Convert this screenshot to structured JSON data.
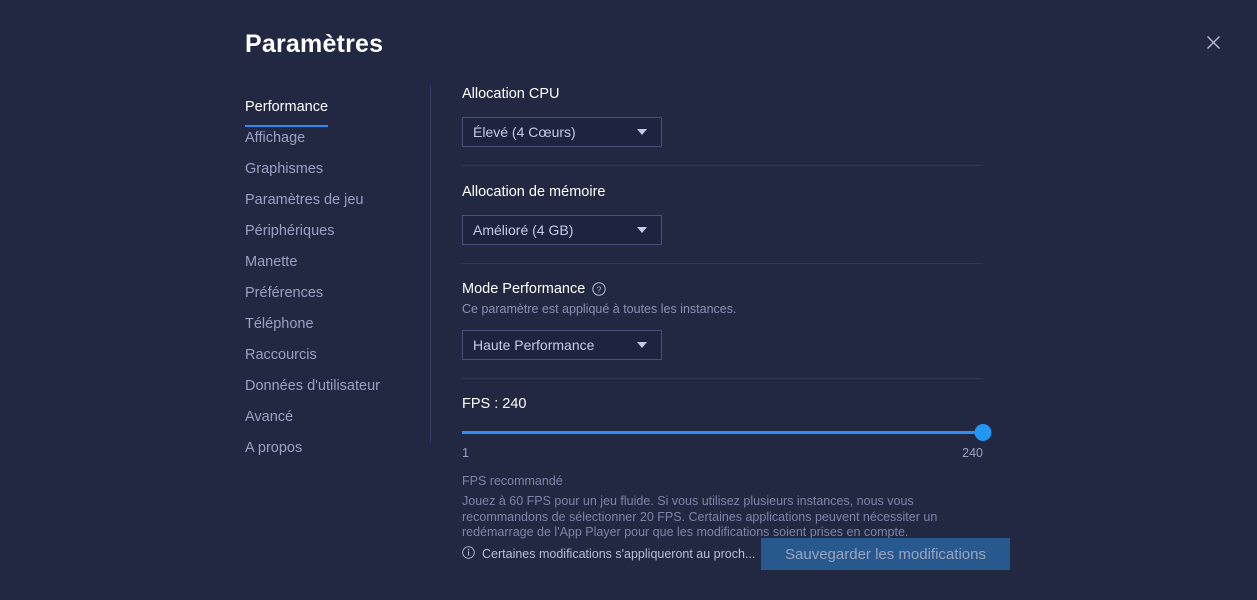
{
  "dialog": {
    "title": "Paramètres",
    "close_icon": "close-icon"
  },
  "sidebar": {
    "items": [
      {
        "label": "Performance",
        "active": true
      },
      {
        "label": "Affichage",
        "active": false
      },
      {
        "label": "Graphismes",
        "active": false
      },
      {
        "label": "Paramètres de jeu",
        "active": false
      },
      {
        "label": "Périphériques",
        "active": false
      },
      {
        "label": "Manette",
        "active": false
      },
      {
        "label": "Préférences",
        "active": false
      },
      {
        "label": "Téléphone",
        "active": false
      },
      {
        "label": "Raccourcis",
        "active": false
      },
      {
        "label": "Données d'utilisateur",
        "active": false
      },
      {
        "label": "Avancé",
        "active": false
      },
      {
        "label": "A propos",
        "active": false
      }
    ]
  },
  "content": {
    "cpu": {
      "label": "Allocation CPU",
      "selected": "Élevé (4 Cœurs)"
    },
    "memory": {
      "label": "Allocation de mémoire",
      "selected": "Amélioré (4 GB)"
    },
    "performance_mode": {
      "label": "Mode Performance",
      "help_icon": "help-circle-icon",
      "note": "Ce paramètre est appliqué à toutes les instances.",
      "selected": "Haute Performance"
    },
    "fps": {
      "value_label": "FPS : 240",
      "value": 240,
      "min": 1,
      "max": 240,
      "min_label": "1",
      "max_label": "240",
      "recommended_title": "FPS recommandé",
      "recommended_body": "Jouez à 60 FPS pour un jeu fluide. Si vous utilisez plusieurs instances, nous vous recommandons de sélectionner 20 FPS. Certaines applications peuvent nécessiter un redémarrage de l'App Player pour que les modifications soient prises en compte."
    }
  },
  "footer": {
    "info_icon": "info-circle-icon",
    "note": "Certaines modifications s'appliqueront au proch...",
    "save_label": "Sauvegarder les modifications"
  },
  "colors": {
    "background": "#222742",
    "accent": "#2d8cf0",
    "slider_thumb": "#2196f3",
    "save_button": "#27598f",
    "text_primary": "#ffffff",
    "text_muted": "#8a91b4"
  }
}
